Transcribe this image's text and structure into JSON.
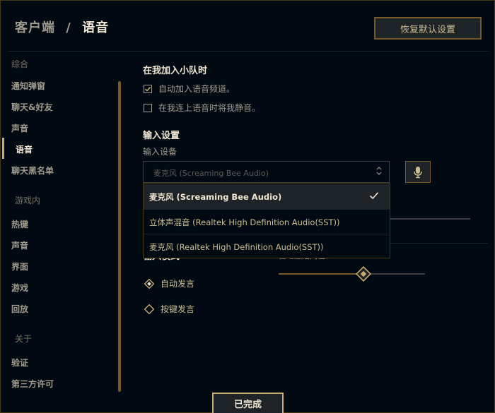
{
  "header": {
    "breadcrumb_parent": "客户端",
    "breadcrumb_separator": "/",
    "breadcrumb_current": "语音",
    "reset_button": "恢复默认设置"
  },
  "sidebar": {
    "sections": [
      {
        "title": "综合",
        "items": [
          "通知弹窗",
          "聊天&好友",
          "声音",
          "语音",
          "聊天黑名单"
        ]
      },
      {
        "title": "游戏内",
        "items": [
          "热键",
          "声音",
          "界面",
          "游戏",
          "回放"
        ]
      },
      {
        "title": "关于",
        "items": [
          "验证",
          "第三方许可"
        ]
      }
    ],
    "active_item": "语音"
  },
  "join_party": {
    "heading": "在我加入小队时",
    "options": [
      {
        "label": "自动加入语音频道。",
        "checked": true
      },
      {
        "label": "在我连上语音时将我静音。",
        "checked": false
      }
    ]
  },
  "input_settings": {
    "heading": "输入设置",
    "device_label": "输入设备",
    "device_value": "麦克风 (Screaming Bee Audio)",
    "device_options": [
      {
        "label": "麦克风 (Screaming Bee Audio)",
        "selected": true
      },
      {
        "label": "立体声混音 (Realtek High Definition Audio(SST))",
        "selected": false
      },
      {
        "label": "麦克风 (Realtek High Definition Audio(SST))",
        "selected": false
      }
    ]
  },
  "input_mode": {
    "heading_partial": "输入模式",
    "threshold_label_partial": "自动激活阈值：55%",
    "threshold_value": 0.58,
    "options": [
      {
        "label": "自动发言",
        "selected": true
      },
      {
        "label": "按键发言",
        "selected": false
      }
    ]
  },
  "footer": {
    "done_button": "已完成"
  },
  "colors": {
    "background": "#010a13",
    "gold": "#c8aa6e",
    "gold_dark": "#785a28",
    "text": "#a09b8c",
    "text_bright": "#f0e6d2"
  },
  "icons": {
    "mic": "microphone-icon",
    "check": "checkmark-icon",
    "caret": "up-down-caret-icon"
  }
}
